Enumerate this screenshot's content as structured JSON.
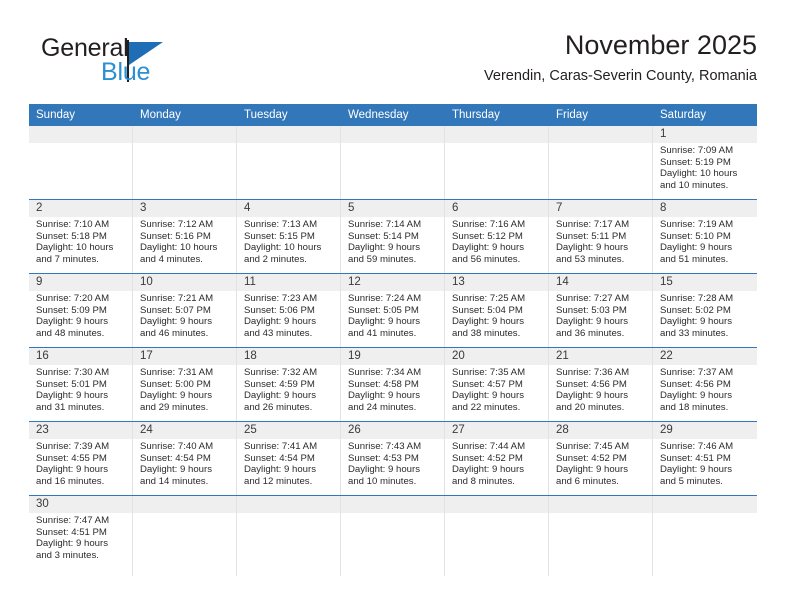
{
  "brand": {
    "name_top": "General",
    "name_bottom": "Blue",
    "accent_color": "#2a8fd4",
    "flag_color": "#1f6db5"
  },
  "header": {
    "month_title": "November 2025",
    "location": "Verendin, Caras-Severin County, Romania"
  },
  "calendar": {
    "header_color": "#3277b9",
    "daynum_band_color": "#efefef",
    "weekday_headers": [
      "Sunday",
      "Monday",
      "Tuesday",
      "Wednesday",
      "Thursday",
      "Friday",
      "Saturday"
    ],
    "weeks": [
      [
        {
          "day": "",
          "sunrise": "",
          "sunset": "",
          "daylight1": "",
          "daylight2": ""
        },
        {
          "day": "",
          "sunrise": "",
          "sunset": "",
          "daylight1": "",
          "daylight2": ""
        },
        {
          "day": "",
          "sunrise": "",
          "sunset": "",
          "daylight1": "",
          "daylight2": ""
        },
        {
          "day": "",
          "sunrise": "",
          "sunset": "",
          "daylight1": "",
          "daylight2": ""
        },
        {
          "day": "",
          "sunrise": "",
          "sunset": "",
          "daylight1": "",
          "daylight2": ""
        },
        {
          "day": "",
          "sunrise": "",
          "sunset": "",
          "daylight1": "",
          "daylight2": ""
        },
        {
          "day": "1",
          "sunrise": "Sunrise: 7:09 AM",
          "sunset": "Sunset: 5:19 PM",
          "daylight1": "Daylight: 10 hours",
          "daylight2": "and 10 minutes."
        }
      ],
      [
        {
          "day": "2",
          "sunrise": "Sunrise: 7:10 AM",
          "sunset": "Sunset: 5:18 PM",
          "daylight1": "Daylight: 10 hours",
          "daylight2": "and 7 minutes."
        },
        {
          "day": "3",
          "sunrise": "Sunrise: 7:12 AM",
          "sunset": "Sunset: 5:16 PM",
          "daylight1": "Daylight: 10 hours",
          "daylight2": "and 4 minutes."
        },
        {
          "day": "4",
          "sunrise": "Sunrise: 7:13 AM",
          "sunset": "Sunset: 5:15 PM",
          "daylight1": "Daylight: 10 hours",
          "daylight2": "and 2 minutes."
        },
        {
          "day": "5",
          "sunrise": "Sunrise: 7:14 AM",
          "sunset": "Sunset: 5:14 PM",
          "daylight1": "Daylight: 9 hours",
          "daylight2": "and 59 minutes."
        },
        {
          "day": "6",
          "sunrise": "Sunrise: 7:16 AM",
          "sunset": "Sunset: 5:12 PM",
          "daylight1": "Daylight: 9 hours",
          "daylight2": "and 56 minutes."
        },
        {
          "day": "7",
          "sunrise": "Sunrise: 7:17 AM",
          "sunset": "Sunset: 5:11 PM",
          "daylight1": "Daylight: 9 hours",
          "daylight2": "and 53 minutes."
        },
        {
          "day": "8",
          "sunrise": "Sunrise: 7:19 AM",
          "sunset": "Sunset: 5:10 PM",
          "daylight1": "Daylight: 9 hours",
          "daylight2": "and 51 minutes."
        }
      ],
      [
        {
          "day": "9",
          "sunrise": "Sunrise: 7:20 AM",
          "sunset": "Sunset: 5:09 PM",
          "daylight1": "Daylight: 9 hours",
          "daylight2": "and 48 minutes."
        },
        {
          "day": "10",
          "sunrise": "Sunrise: 7:21 AM",
          "sunset": "Sunset: 5:07 PM",
          "daylight1": "Daylight: 9 hours",
          "daylight2": "and 46 minutes."
        },
        {
          "day": "11",
          "sunrise": "Sunrise: 7:23 AM",
          "sunset": "Sunset: 5:06 PM",
          "daylight1": "Daylight: 9 hours",
          "daylight2": "and 43 minutes."
        },
        {
          "day": "12",
          "sunrise": "Sunrise: 7:24 AM",
          "sunset": "Sunset: 5:05 PM",
          "daylight1": "Daylight: 9 hours",
          "daylight2": "and 41 minutes."
        },
        {
          "day": "13",
          "sunrise": "Sunrise: 7:25 AM",
          "sunset": "Sunset: 5:04 PM",
          "daylight1": "Daylight: 9 hours",
          "daylight2": "and 38 minutes."
        },
        {
          "day": "14",
          "sunrise": "Sunrise: 7:27 AM",
          "sunset": "Sunset: 5:03 PM",
          "daylight1": "Daylight: 9 hours",
          "daylight2": "and 36 minutes."
        },
        {
          "day": "15",
          "sunrise": "Sunrise: 7:28 AM",
          "sunset": "Sunset: 5:02 PM",
          "daylight1": "Daylight: 9 hours",
          "daylight2": "and 33 minutes."
        }
      ],
      [
        {
          "day": "16",
          "sunrise": "Sunrise: 7:30 AM",
          "sunset": "Sunset: 5:01 PM",
          "daylight1": "Daylight: 9 hours",
          "daylight2": "and 31 minutes."
        },
        {
          "day": "17",
          "sunrise": "Sunrise: 7:31 AM",
          "sunset": "Sunset: 5:00 PM",
          "daylight1": "Daylight: 9 hours",
          "daylight2": "and 29 minutes."
        },
        {
          "day": "18",
          "sunrise": "Sunrise: 7:32 AM",
          "sunset": "Sunset: 4:59 PM",
          "daylight1": "Daylight: 9 hours",
          "daylight2": "and 26 minutes."
        },
        {
          "day": "19",
          "sunrise": "Sunrise: 7:34 AM",
          "sunset": "Sunset: 4:58 PM",
          "daylight1": "Daylight: 9 hours",
          "daylight2": "and 24 minutes."
        },
        {
          "day": "20",
          "sunrise": "Sunrise: 7:35 AM",
          "sunset": "Sunset: 4:57 PM",
          "daylight1": "Daylight: 9 hours",
          "daylight2": "and 22 minutes."
        },
        {
          "day": "21",
          "sunrise": "Sunrise: 7:36 AM",
          "sunset": "Sunset: 4:56 PM",
          "daylight1": "Daylight: 9 hours",
          "daylight2": "and 20 minutes."
        },
        {
          "day": "22",
          "sunrise": "Sunrise: 7:37 AM",
          "sunset": "Sunset: 4:56 PM",
          "daylight1": "Daylight: 9 hours",
          "daylight2": "and 18 minutes."
        }
      ],
      [
        {
          "day": "23",
          "sunrise": "Sunrise: 7:39 AM",
          "sunset": "Sunset: 4:55 PM",
          "daylight1": "Daylight: 9 hours",
          "daylight2": "and 16 minutes."
        },
        {
          "day": "24",
          "sunrise": "Sunrise: 7:40 AM",
          "sunset": "Sunset: 4:54 PM",
          "daylight1": "Daylight: 9 hours",
          "daylight2": "and 14 minutes."
        },
        {
          "day": "25",
          "sunrise": "Sunrise: 7:41 AM",
          "sunset": "Sunset: 4:54 PM",
          "daylight1": "Daylight: 9 hours",
          "daylight2": "and 12 minutes."
        },
        {
          "day": "26",
          "sunrise": "Sunrise: 7:43 AM",
          "sunset": "Sunset: 4:53 PM",
          "daylight1": "Daylight: 9 hours",
          "daylight2": "and 10 minutes."
        },
        {
          "day": "27",
          "sunrise": "Sunrise: 7:44 AM",
          "sunset": "Sunset: 4:52 PM",
          "daylight1": "Daylight: 9 hours",
          "daylight2": "and 8 minutes."
        },
        {
          "day": "28",
          "sunrise": "Sunrise: 7:45 AM",
          "sunset": "Sunset: 4:52 PM",
          "daylight1": "Daylight: 9 hours",
          "daylight2": "and 6 minutes."
        },
        {
          "day": "29",
          "sunrise": "Sunrise: 7:46 AM",
          "sunset": "Sunset: 4:51 PM",
          "daylight1": "Daylight: 9 hours",
          "daylight2": "and 5 minutes."
        }
      ],
      [
        {
          "day": "30",
          "sunrise": "Sunrise: 7:47 AM",
          "sunset": "Sunset: 4:51 PM",
          "daylight1": "Daylight: 9 hours",
          "daylight2": "and 3 minutes."
        },
        {
          "day": "",
          "sunrise": "",
          "sunset": "",
          "daylight1": "",
          "daylight2": ""
        },
        {
          "day": "",
          "sunrise": "",
          "sunset": "",
          "daylight1": "",
          "daylight2": ""
        },
        {
          "day": "",
          "sunrise": "",
          "sunset": "",
          "daylight1": "",
          "daylight2": ""
        },
        {
          "day": "",
          "sunrise": "",
          "sunset": "",
          "daylight1": "",
          "daylight2": ""
        },
        {
          "day": "",
          "sunrise": "",
          "sunset": "",
          "daylight1": "",
          "daylight2": ""
        },
        {
          "day": "",
          "sunrise": "",
          "sunset": "",
          "daylight1": "",
          "daylight2": ""
        }
      ]
    ]
  }
}
